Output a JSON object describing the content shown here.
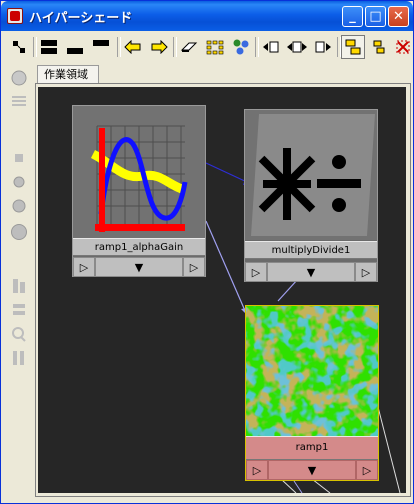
{
  "window": {
    "title": "ハイパーシェード"
  },
  "window_buttons": {
    "minimize": "_",
    "maximize": "□",
    "close": "✕"
  },
  "tabs": [
    {
      "label": "作業領域"
    }
  ],
  "nodes": [
    {
      "label": "ramp1_alphaGain",
      "left_arrow": "▷",
      "mid_arrow": "▼",
      "right_arrow": "▷"
    },
    {
      "label": "multiplyDivide1",
      "left_arrow": "▷",
      "mid_arrow": "▼",
      "right_arrow": "▷"
    },
    {
      "label": "ramp1",
      "left_arrow": "▷",
      "mid_arrow": "▼",
      "right_arrow": "▷"
    }
  ],
  "colors": {
    "titlebar": "#0a5ee6",
    "canvas_bg": "#262626",
    "selected_node": "#d48a8a",
    "connection_blue": "#2e2ed6",
    "connection_lavender": "#a0a0f0",
    "connection_white": "#ffffff"
  },
  "toolbar_icons": [
    "graph-icon",
    "layout-top-icon",
    "layout-bottom-icon",
    "layout-single-icon",
    "arrow-left-icon",
    "arrow-right-icon",
    "eraser-icon",
    "grid-icon",
    "network-icon",
    "input-connections-icon",
    "input-output-connections-icon",
    "output-connections-icon",
    "tile-icon",
    "tile-small-icon",
    "clear-icon"
  ],
  "sidebar_icons": [
    "sphere-icon",
    "list-icon",
    "small-square-icon",
    "sphere-icon",
    "sphere-icon",
    "sphere-icon",
    "sort-icon",
    "sort-icon",
    "zoom-icon",
    "sort-icon"
  ]
}
